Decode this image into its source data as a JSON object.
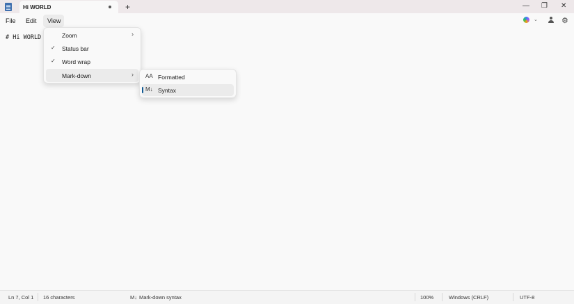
{
  "window": {
    "tab_title": "Hi WORLD",
    "new_tab_glyph": "+",
    "min_glyph": "—",
    "max_glyph": "❐",
    "close_glyph": "✕"
  },
  "menubar": {
    "file": "File",
    "edit": "Edit",
    "view": "View",
    "right_icons": [
      "copilot-icon",
      "chevron-down-icon",
      "account-icon",
      "gear-icon"
    ]
  },
  "editor": {
    "content": "# Hi WORLD"
  },
  "view_menu": {
    "items": [
      {
        "label": "Zoom",
        "checked": false,
        "submenu": true
      },
      {
        "label": "Status bar",
        "checked": true,
        "submenu": false
      },
      {
        "label": "Word wrap",
        "checked": true,
        "submenu": false
      },
      {
        "label": "Mark-down",
        "checked": false,
        "submenu": true,
        "highlighted": true
      }
    ]
  },
  "markdown_submenu": {
    "items": [
      {
        "label": "Formatted",
        "icon": "formatted-text-icon",
        "icon_glyph": "AA",
        "selected": false
      },
      {
        "label": "Syntax",
        "icon": "markdown-icon",
        "icon_glyph": "M↓",
        "selected": true
      }
    ],
    "selection_color": "#0f5a94"
  },
  "statusbar": {
    "position": "Ln 7, Col 1",
    "characters": "16 characters",
    "markdown_mode": "Mark-down syntax",
    "markdown_glyph": "M↓",
    "zoom": "100%",
    "line_ending": "Windows (CRLF)",
    "encoding": "UTF-8"
  }
}
